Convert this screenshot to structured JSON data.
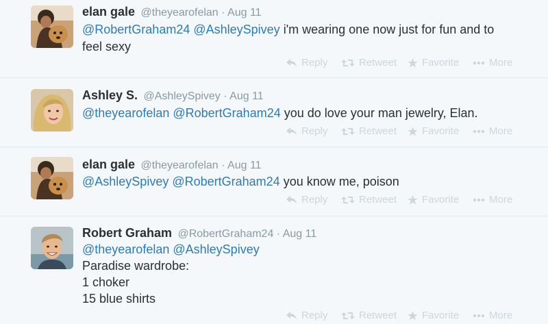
{
  "colors": {
    "background": "#f5f8fa",
    "link": "#2b7bb9",
    "muted": "#8899a6",
    "action": "#ccd6dd",
    "divider": "#e1e8ed"
  },
  "actions": {
    "reply": "Reply",
    "retweet": "Retweet",
    "favorite": "Favorite",
    "more": "More"
  },
  "tweets": [
    {
      "name": "elan gale",
      "handle": "@theyearofelan",
      "separator": "·",
      "time": "Aug 11",
      "mentions": [
        "@RobertGraham24",
        "@AshleySpivey"
      ],
      "text_lines": [
        "i'm wearing one now just for fun and to",
        "feel sexy"
      ],
      "avatar_icon": "person-with-dog-avatar"
    },
    {
      "name": "Ashley S.",
      "handle": "@AshleySpivey",
      "separator": "·",
      "time": "Aug 11",
      "mentions": [
        "@theyearofelan",
        "@RobertGraham24"
      ],
      "text_lines": [
        "you do love your man jewelry, Elan."
      ],
      "avatar_icon": "blonde-woman-avatar"
    },
    {
      "name": "elan gale",
      "handle": "@theyearofelan",
      "separator": "·",
      "time": "Aug 11",
      "mentions": [
        "@AshleySpivey",
        "@RobertGraham24"
      ],
      "text_lines": [
        "you know me, poison"
      ],
      "avatar_icon": "person-with-dog-avatar"
    },
    {
      "name": "Robert Graham",
      "handle": "@RobertGraham24",
      "separator": "·",
      "time": "Aug 11",
      "mentions": [
        "@theyearofelan",
        "@AshleySpivey"
      ],
      "text_lines": [
        "Paradise wardrobe:",
        "1 choker",
        "15 blue shirts"
      ],
      "avatar_icon": "smiling-man-avatar"
    }
  ]
}
